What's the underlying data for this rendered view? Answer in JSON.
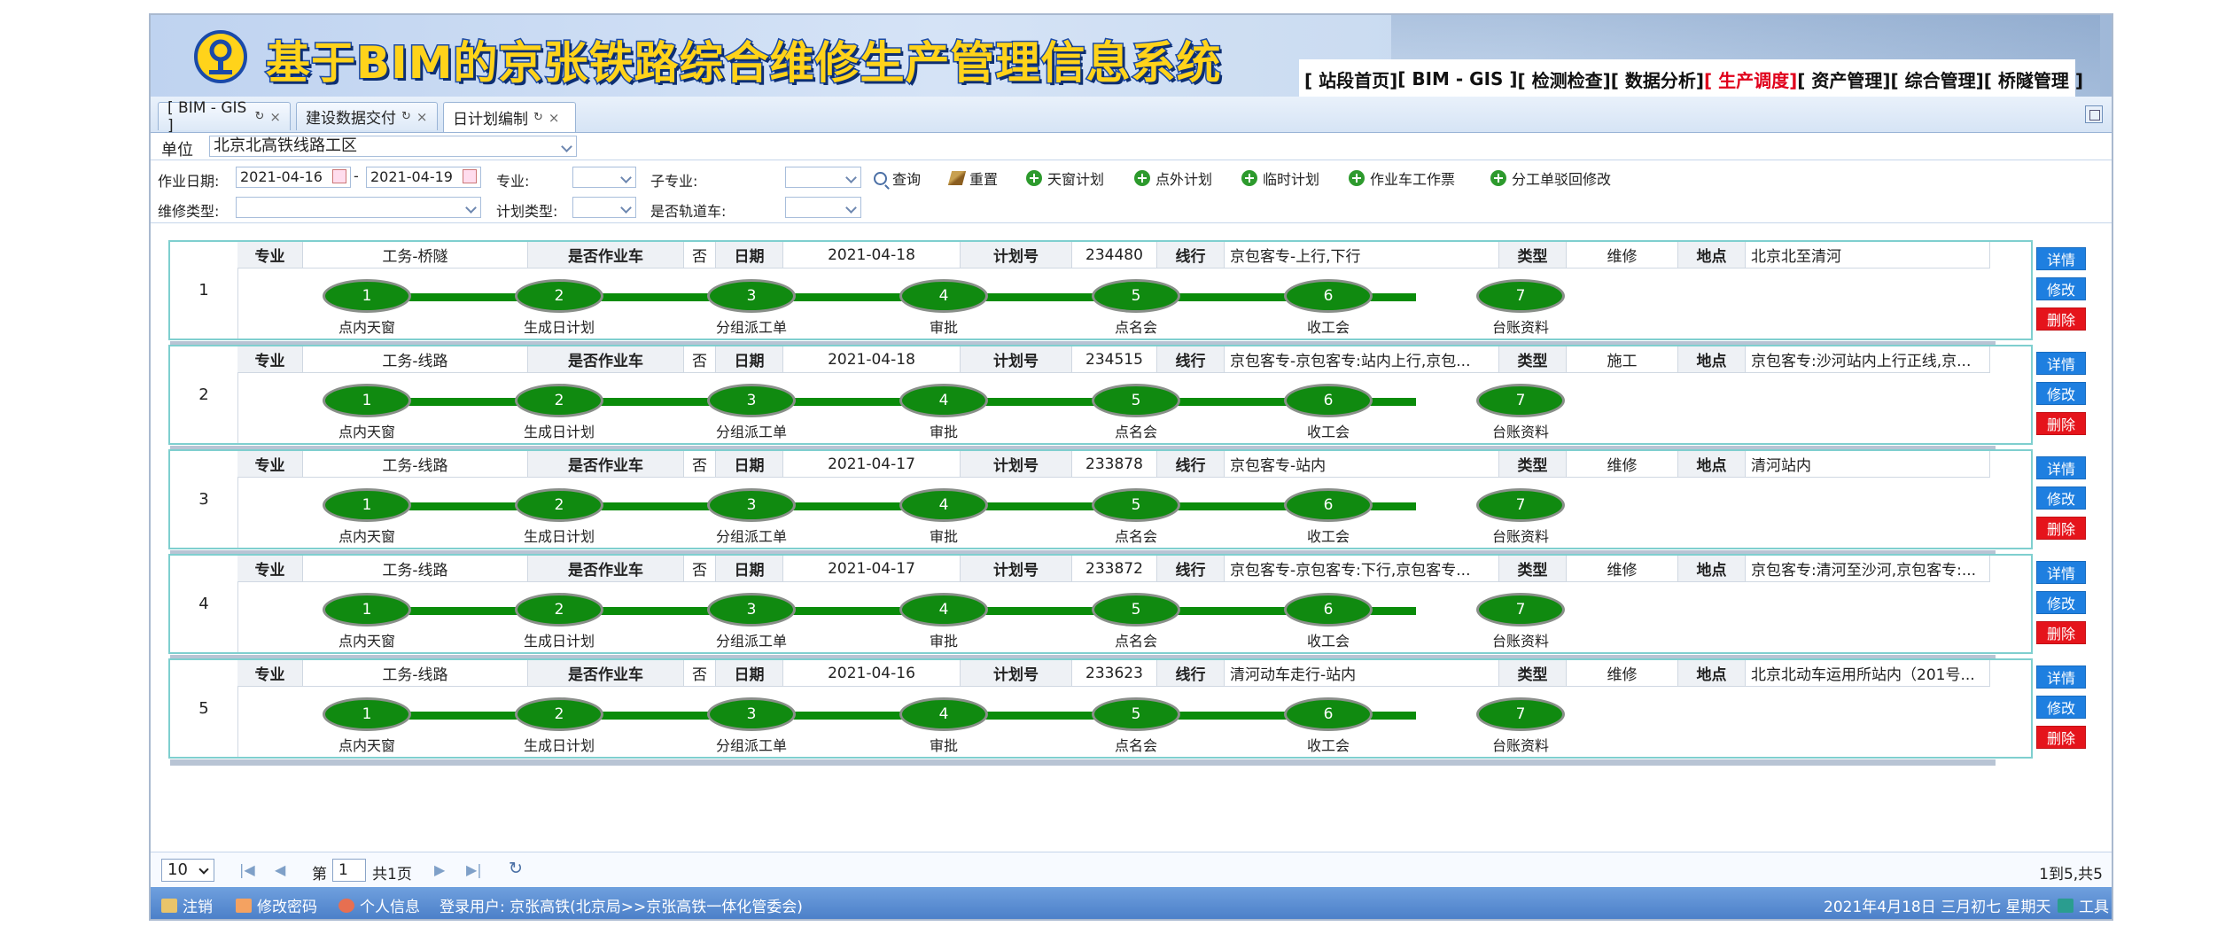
{
  "header": {
    "title": "基于BIM的京张铁路综合维修生产管理信息系统",
    "nav": [
      {
        "label": "[ 站段首页]",
        "active": false
      },
      {
        "label": "[ BIM - GIS ]",
        "active": false
      },
      {
        "label": "[ 检测检查]",
        "active": false
      },
      {
        "label": "[ 数据分析]",
        "active": false
      },
      {
        "label": "[ 生产调度]",
        "active": true
      },
      {
        "label": "[ 资产管理]",
        "active": false
      },
      {
        "label": "[ 综合管理]",
        "active": false
      },
      {
        "label": "[ 桥隧管理 ]",
        "active": false
      }
    ]
  },
  "tabs": [
    {
      "label": "[ BIM - GIS ]",
      "active": false
    },
    {
      "label": "建设数据交付",
      "active": false
    },
    {
      "label": "日计划编制",
      "active": true
    }
  ],
  "unit": {
    "label": "单位",
    "value": "北京北高铁线路工区"
  },
  "filter": {
    "date_label": "作业日期:",
    "date_from": "2021-04-16",
    "date_sep": "-",
    "date_to": "2021-04-19",
    "specialty_label": "专业:",
    "sub_specialty_label": "子专业:",
    "repair_type_label": "维修类型:",
    "plan_type_label": "计划类型:",
    "rail_car_label": "是否轨道车:",
    "buttons": [
      "查询",
      "重置",
      "天窗计划",
      "点外计划",
      "临时计划",
      "作业车工作票",
      "分工单驳回修改"
    ]
  },
  "labels": {
    "specialty": "专业",
    "is_vehicle": "是否作业车",
    "date": "日期",
    "plan_no": "计划号",
    "line": "线行",
    "type": "类型",
    "location": "地点"
  },
  "steps": [
    {
      "num": "1",
      "label": "点内天窗"
    },
    {
      "num": "2",
      "label": "生成日计划"
    },
    {
      "num": "3",
      "label": "分组派工单"
    },
    {
      "num": "4",
      "label": "审批"
    },
    {
      "num": "5",
      "label": "点名会"
    },
    {
      "num": "6",
      "label": "收工会"
    },
    {
      "num": "7",
      "label": "台账资料"
    }
  ],
  "actions": {
    "detail": "详情",
    "edit": "修改",
    "delete": "删除"
  },
  "plans": [
    {
      "index": "1",
      "specialty": "工务-桥隧",
      "is_vehicle": "否",
      "date": "2021-04-18",
      "plan_no": "234480",
      "line": "京包客专-上行,下行",
      "type": "维修",
      "location": "北京北至清河"
    },
    {
      "index": "2",
      "specialty": "工务-线路",
      "is_vehicle": "否",
      "date": "2021-04-18",
      "plan_no": "234515",
      "line": "京包客专-京包客专:站内上行,京包...",
      "type": "施工",
      "location": "京包客专:沙河站内上行正线,京..."
    },
    {
      "index": "3",
      "specialty": "工务-线路",
      "is_vehicle": "否",
      "date": "2021-04-17",
      "plan_no": "233878",
      "line": "京包客专-站内",
      "type": "维修",
      "location": "清河站内"
    },
    {
      "index": "4",
      "specialty": "工务-线路",
      "is_vehicle": "否",
      "date": "2021-04-17",
      "plan_no": "233872",
      "line": "京包客专-京包客专:下行,京包客专...",
      "type": "维修",
      "location": "京包客专:清河至沙河,京包客专:..."
    },
    {
      "index": "5",
      "specialty": "工务-线路",
      "is_vehicle": "否",
      "date": "2021-04-16",
      "plan_no": "233623",
      "line": "清河动车走行-站内",
      "type": "维修",
      "location": "北京北动车运用所站内（201号..."
    }
  ],
  "pager": {
    "page_size": "10",
    "page_prefix": "第",
    "page": "1",
    "page_total": "共1页",
    "summary": "1到5,共5"
  },
  "statusbar": {
    "logout": "注销",
    "change_pwd": "修改密码",
    "profile": "个人信息",
    "login_user": "登录用户: 京张高铁(北京局>>京张高铁一体化管委会)",
    "date": "2021年4月18日 三月初七 星期天",
    "tools": "工具"
  }
}
